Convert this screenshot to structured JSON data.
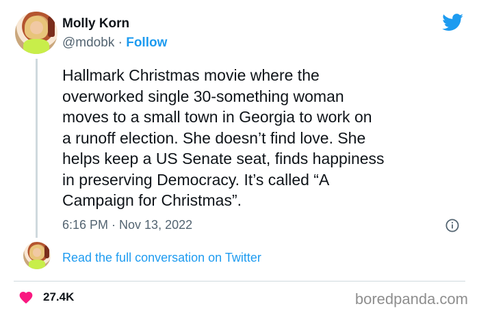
{
  "tweet": {
    "author_name": "Molly Korn",
    "handle": "@mdobk",
    "separator": " · ",
    "follow_label": "Follow",
    "text": "Hallmark Christmas movie where the\noverworked single 30-something woman\nmoves to a small town in Georgia to work on\na runoff election. She doesn’t find love. She\nhelps keep a US Senate seat, finds happiness\nin preserving Democracy. It’s called “A\nCampaign for Christmas”.",
    "timestamp": "6:16 PM · Nov 13, 2022",
    "conversation_link": "Read the full conversation on Twitter",
    "likes": "27.4K"
  },
  "watermark": "boredpanda.com",
  "icons": {
    "brand": "twitter-bird-icon",
    "info": "info-icon",
    "like": "heart-icon"
  },
  "colors": {
    "accent": "#1d9bf0",
    "heart": "#f91880",
    "muted": "#536471",
    "text": "#0f1419"
  }
}
